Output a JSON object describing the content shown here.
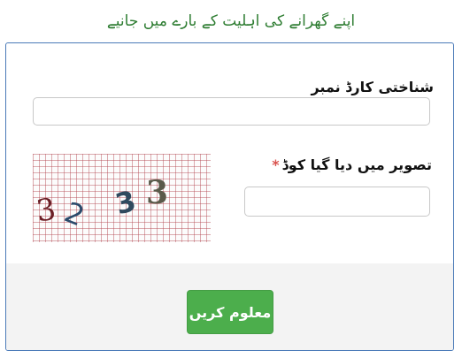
{
  "page": {
    "title": "اپنے گھرانے کی اہلیت کے بارے میں جانیے"
  },
  "form": {
    "cnic_label": "شناختی کارڈ نمبر",
    "cnic_value": "",
    "captcha_label": "تصویر میں دیا گیا کوڈ",
    "captcha_required_marker": "*",
    "captcha_value": "",
    "captcha_code": [
      "3",
      "2",
      "3",
      "3"
    ],
    "submit_label": "معلوم کریں"
  },
  "colors": {
    "title": "#2e7d32",
    "button": "#4cae4c",
    "required": "#d9534f",
    "card_border": "#4a7ab8"
  }
}
